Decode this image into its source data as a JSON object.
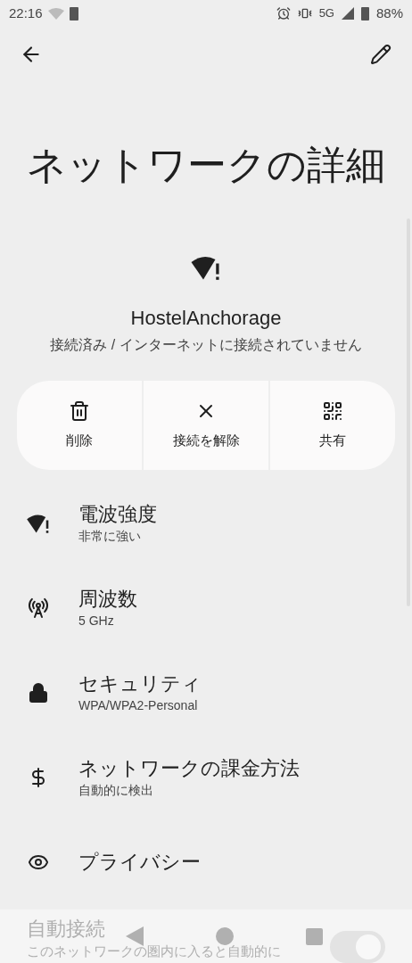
{
  "status_bar": {
    "time": "22:16",
    "network": "5G",
    "battery": "88%"
  },
  "title": "ネットワークの詳細",
  "network": {
    "name": "HostelAnchorage",
    "status": "接続済み / インターネットに接続されていません"
  },
  "actions": [
    {
      "kind": "delete",
      "label": "削除"
    },
    {
      "kind": "disconnect",
      "label": "接続を解除"
    },
    {
      "kind": "share",
      "label": "共有"
    }
  ],
  "details": [
    {
      "kind": "signal",
      "title": "電波強度",
      "value": "非常に強い"
    },
    {
      "kind": "frequency",
      "title": "周波数",
      "value": "5 GHz"
    },
    {
      "kind": "security",
      "title": "セキュリティ",
      "value": "WPA/WPA2-Personal"
    },
    {
      "kind": "metered",
      "title": "ネットワークの課金方法",
      "value": "自動的に検出"
    },
    {
      "kind": "privacy",
      "title": "プライバシー"
    }
  ],
  "auto_connect": {
    "title": "自動接続",
    "description": "このネットワークの圏内に入ると自動的に",
    "on": true
  }
}
